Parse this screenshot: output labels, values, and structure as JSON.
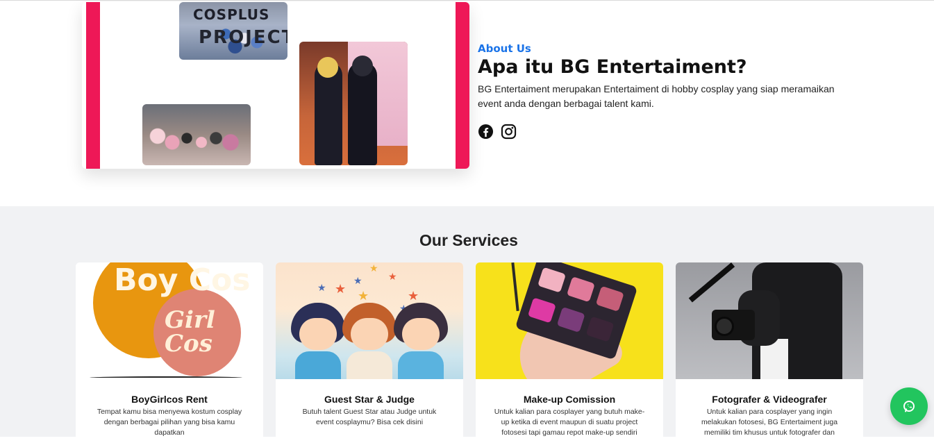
{
  "about": {
    "kicker": "About Us",
    "title": "Apa itu BG Entertaiment?",
    "description": "BG Entertaiment merupakan Entertaiment di hobby cosplay yang siap meramaikan event anda dengan berbagai talent kami.",
    "socials": [
      "facebook-icon",
      "instagram-icon"
    ],
    "photo1_text_top": "COSPLUS",
    "photo1_text_bottom": "PROJECT",
    "accent_color": "#ee1857",
    "kicker_color": "#1a73e8"
  },
  "services": {
    "title": "Our Services",
    "cards": [
      {
        "title": "BoyGirlcos Rent",
        "description": "Tempat kamu bisa menyewa kostum cosplay dengan berbagai pilihan yang bisa kamu dapatkan",
        "image_text_1": "Boy Cos",
        "image_text_2": "Girl Cos"
      },
      {
        "title": "Guest Star & Judge",
        "description": "Butuh talent Guest Star atau Judge untuk event cosplaymu? Bisa cek disini"
      },
      {
        "title": "Make-up Comission",
        "description": "Untuk kalian para cosplayer yang butuh make-up ketika di event maupun di suatu project fotosesi tapi gamau repot make-up sendiri"
      },
      {
        "title": "Fotografer & Videografer",
        "description": "Untuk kalian para cosplayer yang ingin melakukan fotosesi, BG Entertaiment juga memiliki tim khusus untuk fotografer dan"
      }
    ]
  },
  "floating": {
    "icon": "whatsapp-icon",
    "color": "#22c55e"
  }
}
